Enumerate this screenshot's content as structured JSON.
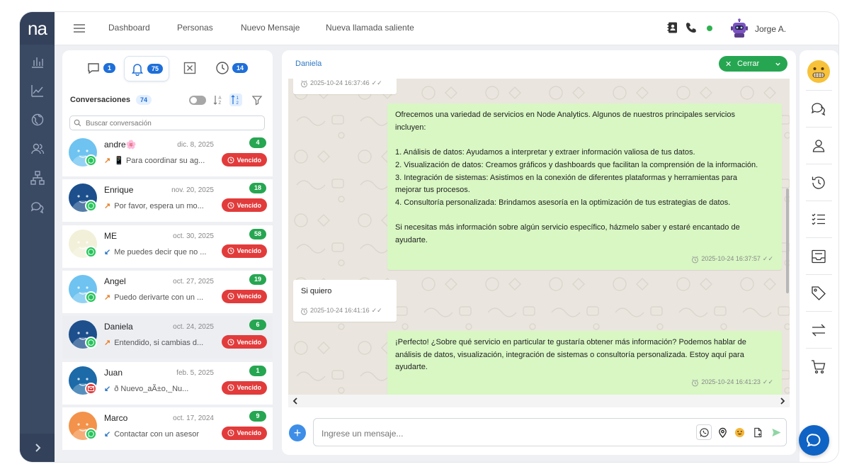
{
  "app": {
    "logo": "na"
  },
  "topbar": {
    "nav": [
      "Dashboard",
      "Personas",
      "Nuevo Mensaje",
      "Nueva llamada saliente"
    ],
    "user_name": "Jorge A."
  },
  "filters": {
    "chats": "1",
    "notifications": "75",
    "closed": "",
    "pending": "14"
  },
  "conversations": {
    "title": "Conversaciones",
    "count": "74",
    "search_placeholder": "Buscar conversación",
    "vencido_label": "Vencido",
    "items": [
      {
        "name": "andre🌸",
        "date": "dic. 8, 2025",
        "dir": "↗",
        "message": "📱 Para coordinar su ag...",
        "unread": "4",
        "channel": "whatsapp",
        "color": "#6ec3f0"
      },
      {
        "name": "Enrique",
        "date": "nov. 20, 2025",
        "dir": "↗",
        "message": "Por favor, espera un mo...",
        "unread": "18",
        "channel": "whatsapp",
        "color": "#1c4f8c"
      },
      {
        "name": "ME",
        "date": "oct. 30, 2025",
        "dir": "↙",
        "message": "Me puedes decir que no ...",
        "unread": "58",
        "channel": "whatsapp",
        "color": "#f2f0d9"
      },
      {
        "name": "Angel",
        "date": "oct. 27, 2025",
        "dir": "↗",
        "message": "Puedo derivarte con un ...",
        "unread": "19",
        "channel": "whatsapp",
        "color": "#6ec3f0"
      },
      {
        "name": "Daniela",
        "date": "oct. 24, 2025",
        "dir": "↗",
        "message": "Entendido, si cambias d...",
        "unread": "6",
        "channel": "whatsapp",
        "color": "#1c4f8c"
      },
      {
        "name": "Juan",
        "date": "feb. 5, 2025",
        "dir": "↙",
        "message": "ð Nuevo_aÃ±o,_Nu...",
        "unread": "1",
        "channel": "email",
        "color": "#1c6aa8"
      },
      {
        "name": "Marco",
        "date": "oct. 17, 2024",
        "dir": "↙",
        "message": "Contactar con un asesor",
        "unread": "9",
        "channel": "whatsapp",
        "color": "#f3924a"
      }
    ]
  },
  "chat": {
    "contact": "Daniela",
    "close_label": "Cerrar",
    "input_placeholder": "Ingrese un mensaje...",
    "messages": [
      {
        "from": "in",
        "text": "",
        "time": "2025-10-24 16:37:46"
      },
      {
        "from": "out",
        "text": "Ofrecemos una variedad de servicios en Node Analytics. Algunos de nuestros principales servicios\nincluyen:\n\n1. Análisis de datos: Ayudamos a interpretar y extraer información valiosa de tus datos.\n2. Visualización de datos: Creamos gráficos y dashboards que facilitan la comprensión de la información.\n3. Integración de sistemas: Asistimos en la conexión de diferentes plataformas y herramientas para\nmejorar tus procesos.\n4. Consultoría personalizada: Brindamos asesoría en la optimización de tus estrategias de datos.\n\nSi necesitas más información sobre algún servicio específico, házmelo saber y estaré encantado de\nayudarte.",
        "time": "2025-10-24 16:37:57"
      },
      {
        "from": "in",
        "text": "Si quiero",
        "time": "2025-10-24 16:41:16"
      },
      {
        "from": "out",
        "text": "¡Perfecto! ¿Sobre qué servicio en particular te gustaría obtener más información? Podemos hablar de\nanálisis de datos, visualización, integración de sistemas o consultoría personalizada. Estoy aquí para\nayudarte.",
        "time": "2025-10-24 16:41:23"
      }
    ]
  },
  "colors": {
    "accent": "#1e6fd9",
    "success": "#26a651",
    "danger": "#e23b3b",
    "rail": "#3b4a63",
    "bubble_out": "#d8f7c3"
  }
}
